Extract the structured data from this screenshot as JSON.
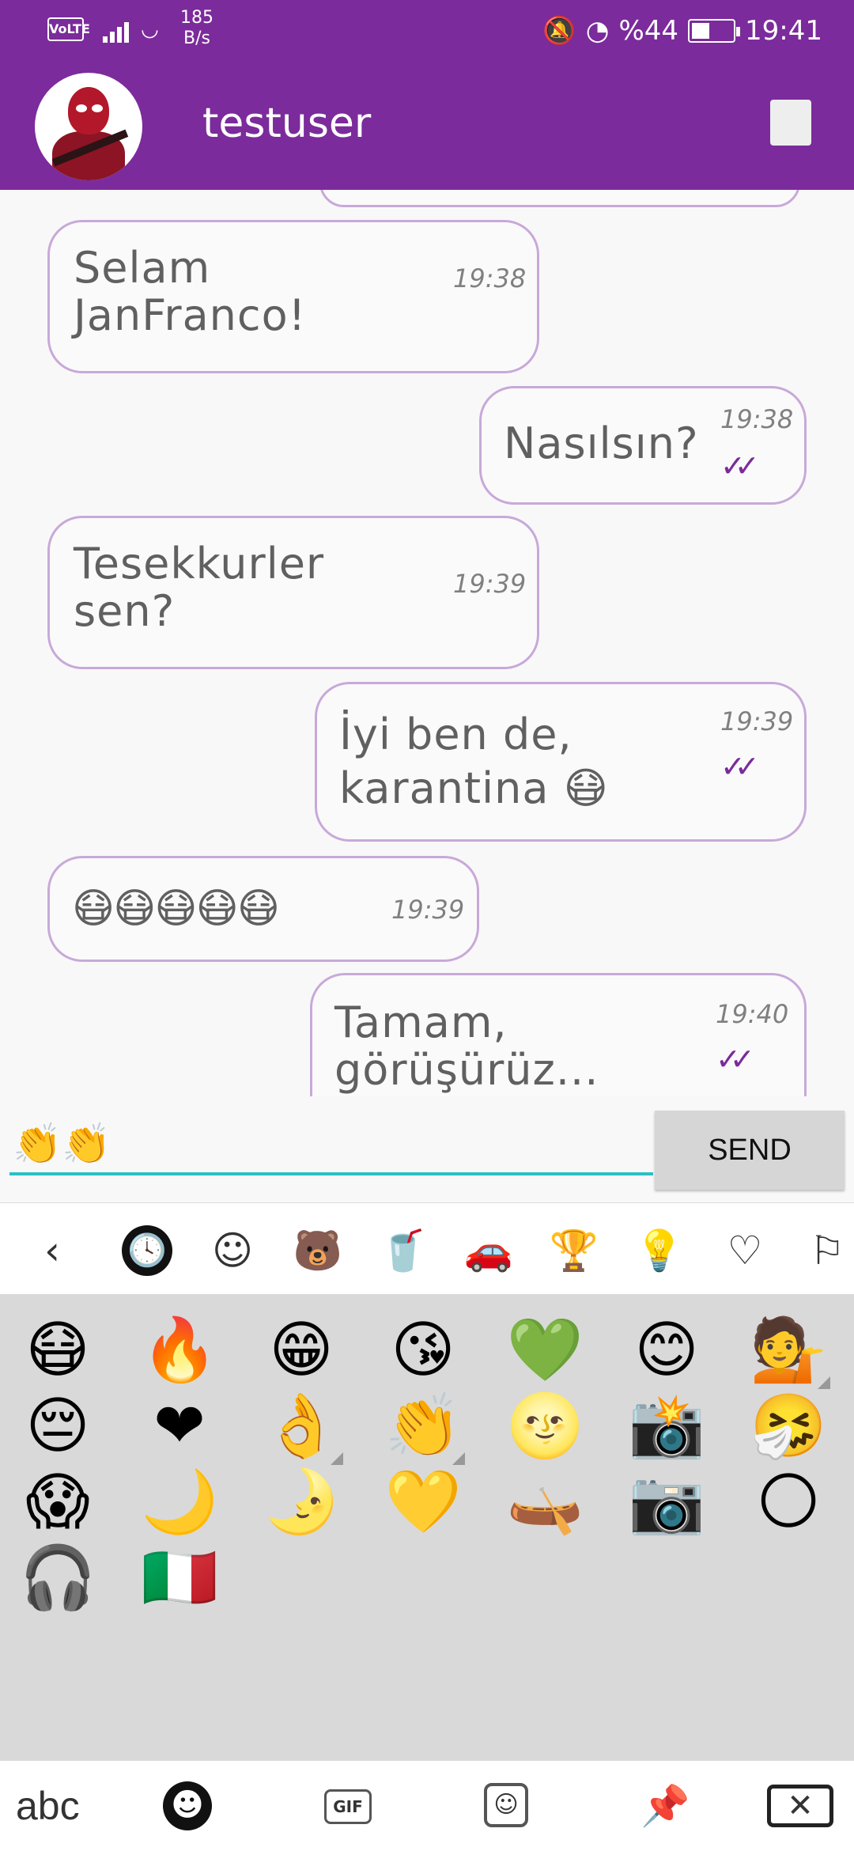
{
  "status_bar": {
    "volte": "VoLTE",
    "net_speed_value": "185",
    "net_speed_unit": "B/s",
    "battery_text": "%44",
    "battery_level": 44,
    "time": "19:41",
    "icons": [
      "volte-icon",
      "signal-icon",
      "wifi-icon",
      "mute-icon",
      "speedometer-icon",
      "battery-icon"
    ]
  },
  "header": {
    "title": "testuser",
    "avatar": "deadpool-avatar",
    "menu_icon": "square-icon"
  },
  "messages": [
    {
      "text": "Selam\nJanFranco!",
      "time": "19:38",
      "side": "left",
      "read": false
    },
    {
      "text": "Nasılsın?",
      "time": "19:38",
      "side": "right",
      "read": true
    },
    {
      "text": "Tesekkurler\nsen?",
      "time": "19:39",
      "side": "left",
      "read": false
    },
    {
      "text": "İyi ben de,\nkarantina 😷",
      "time": "19:39",
      "side": "right",
      "read": true
    },
    {
      "text": "😷😷😷😷😷",
      "time": "19:39",
      "side": "left",
      "read": false
    },
    {
      "text": "Tamam,\ngörüşürüz...",
      "time": "19:40",
      "side": "right",
      "read": true
    }
  ],
  "tick_glyph": "✓✓",
  "input": {
    "value": "👏👏",
    "send_label": "SEND"
  },
  "emoji_categories": {
    "back": "‹",
    "items": [
      {
        "name": "recent",
        "glyph": "🕓"
      },
      {
        "name": "smileys",
        "glyph": "☺"
      },
      {
        "name": "animals",
        "glyph": "🐻"
      },
      {
        "name": "food",
        "glyph": "🥤"
      },
      {
        "name": "travel",
        "glyph": "🚗"
      },
      {
        "name": "activities",
        "glyph": "🏆"
      },
      {
        "name": "objects",
        "glyph": "💡"
      },
      {
        "name": "symbols",
        "glyph": "♡"
      },
      {
        "name": "flags",
        "glyph": "⚐"
      }
    ]
  },
  "emoji_grid": [
    "😷",
    "🔥",
    "😁",
    "😘",
    "💚",
    "😊",
    "💁",
    "😔",
    "❤",
    "👌",
    "👏",
    "🌝",
    "📸",
    "🤧",
    "😱",
    "🌙",
    "🌛",
    "💛",
    "🛶",
    "📷",
    "🌕",
    "🎧",
    "🇮🇹"
  ],
  "emoji_variants": [
    6,
    9,
    10
  ],
  "bottom_bar": {
    "abc": "abc",
    "emoji": "☻",
    "gif": "GIF",
    "sticker": "☺",
    "pin": "📌",
    "backspace": "✕"
  }
}
